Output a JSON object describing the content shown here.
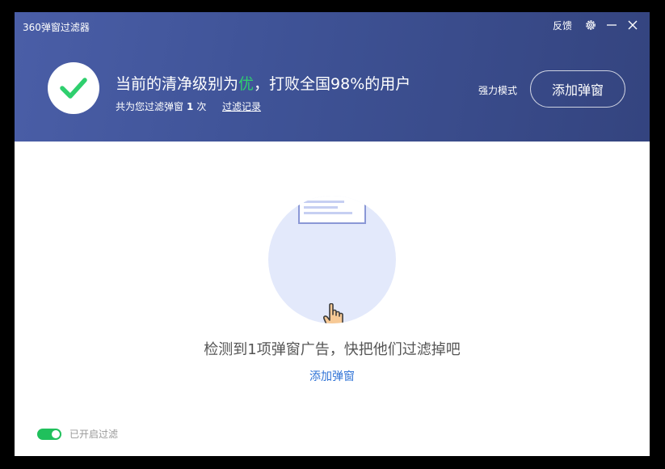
{
  "window": {
    "title": "360弹窗过滤器"
  },
  "controls": {
    "feedback": "反馈",
    "settings_icon": "gear-icon",
    "minimize_icon": "minimize-icon",
    "close_icon": "close-icon"
  },
  "status": {
    "icon": "checkmark-icon",
    "headline_prefix": "当前的清净级别为",
    "grade": "优",
    "headline_suffix": "，打败全国98%的用户",
    "sub_prefix": "共为您过滤弹窗",
    "filter_count": "1",
    "sub_suffix": "次",
    "history_link": "过滤记录",
    "strong_mode": "强力模式",
    "add_button": "添加弹窗"
  },
  "main": {
    "illustration_icon": "hand-pointer-icon",
    "empty_text": "检测到1项弹窗广告，快把他们过滤掉吧",
    "empty_link": "添加弹窗"
  },
  "footer": {
    "toggle_on": true,
    "toggle_label": "已开启过滤"
  },
  "colors": {
    "header_bg": "#3f5397",
    "grade_green": "#2fcf6e",
    "check_green": "#2fcf6e",
    "link_blue": "#2f73d6",
    "toggle_green": "#20c05c",
    "illustration_bg": "#e3e9fb"
  }
}
